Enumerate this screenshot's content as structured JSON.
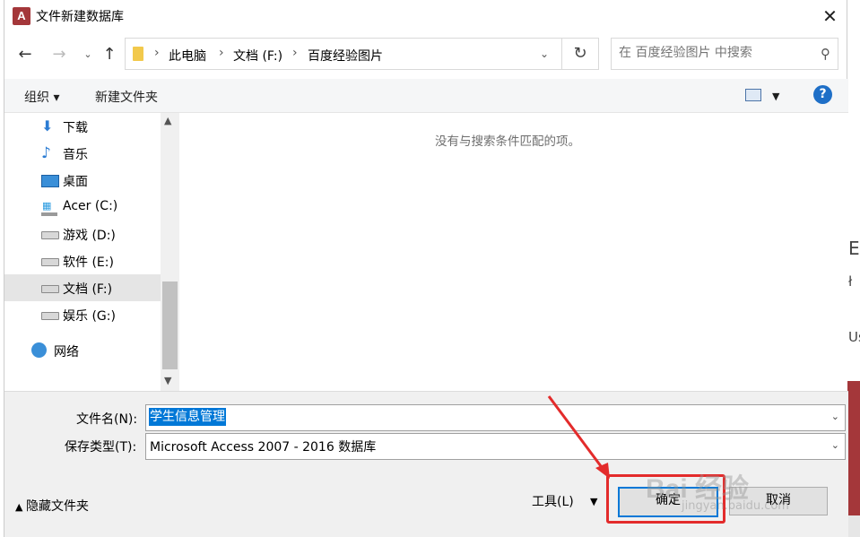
{
  "window": {
    "title": "文件新建数据库",
    "app_icon": "A",
    "close_glyph": "✕"
  },
  "address": {
    "crumbs": [
      "此电脑",
      "文档 (F:)",
      "百度经验图片"
    ],
    "search_placeholder": "在 百度经验图片 中搜索"
  },
  "toolbar": {
    "organize": "组织 ▾",
    "new_folder": "新建文件夹",
    "help": "?"
  },
  "nav": {
    "items": [
      {
        "label": "下载",
        "icon": "download-icon"
      },
      {
        "label": "音乐",
        "icon": "music-icon"
      },
      {
        "label": "桌面",
        "icon": "desktop-icon"
      },
      {
        "label": "Acer (C:)",
        "icon": "windows-drive-icon"
      },
      {
        "label": "游戏 (D:)",
        "icon": "drive-icon"
      },
      {
        "label": "软件 (E:)",
        "icon": "drive-icon"
      },
      {
        "label": "文档 (F:)",
        "icon": "drive-icon",
        "selected": true
      },
      {
        "label": "娱乐 (G:)",
        "icon": "drive-icon"
      },
      {
        "label": "网络",
        "icon": "network-icon"
      }
    ]
  },
  "content": {
    "empty_message": "没有与搜索条件匹配的项。"
  },
  "form": {
    "filename_label": "文件名(N):",
    "filename_value": "学生信息管理",
    "filetype_label": "保存类型(T):",
    "filetype_value": "Microsoft Access 2007 - 2016 数据库",
    "hide_folders": "隐藏文件夹",
    "tools": "工具(L)",
    "ok": "确定",
    "cancel": "取消"
  },
  "background_fragments": [
    "E",
    "ł",
    "Us"
  ],
  "watermark": {
    "main": "Bai 经验",
    "sub": "jingyan.baidu.com"
  },
  "colors": {
    "accent": "#0078d7",
    "highlight": "#e32b2b",
    "app_brand": "#a4373a"
  }
}
